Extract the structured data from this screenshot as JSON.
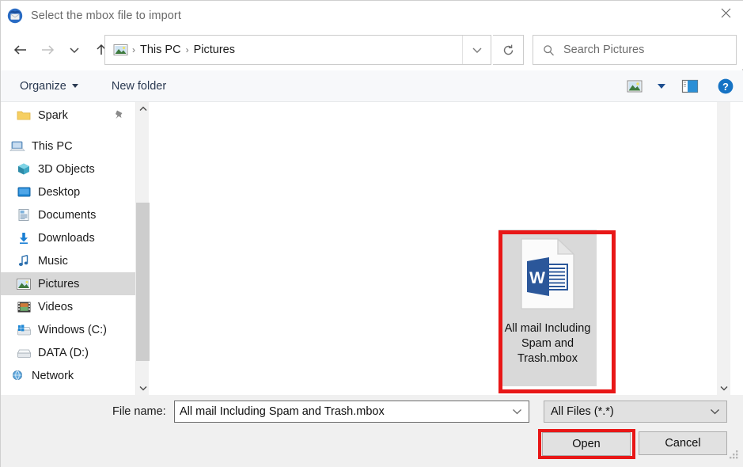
{
  "window": {
    "title": "Select the mbox file to import",
    "app_icon": "thunderbird-icon",
    "close_label": "✕"
  },
  "navigation": {
    "back_icon": "arrow-left-icon",
    "forward_icon": "arrow-right-icon",
    "recent_icon": "chevron-down-icon",
    "up_icon": "arrow-up-icon",
    "breadcrumb": {
      "location_icon": "pictures-folder-icon",
      "items": [
        "This PC",
        "Pictures"
      ],
      "separator": "›",
      "dropdown_icon": "chevron-down-icon"
    },
    "refresh_icon": "refresh-icon",
    "search": {
      "icon": "search-icon",
      "placeholder": "Search Pictures",
      "value": ""
    }
  },
  "toolbar": {
    "organize_label": "Organize",
    "new_folder_label": "New folder",
    "view_icon": "thumbnail-view-icon",
    "view_dropdown_icon": "chevron-down-icon",
    "preview_pane_icon": "preview-pane-icon",
    "help_icon": "help-icon",
    "help_label": "?"
  },
  "sidebar": {
    "items": [
      {
        "label": "Spark",
        "icon": "folder-icon",
        "selected": false,
        "pinned": true,
        "indent": 18
      },
      {
        "label": "This PC",
        "icon": "computer-icon",
        "selected": false,
        "pinned": false,
        "indent": 10
      },
      {
        "label": "3D Objects",
        "icon": "cube-icon",
        "selected": false,
        "pinned": false,
        "indent": 18
      },
      {
        "label": "Desktop",
        "icon": "desktop-icon",
        "selected": false,
        "pinned": false,
        "indent": 18
      },
      {
        "label": "Documents",
        "icon": "documents-icon",
        "selected": false,
        "pinned": false,
        "indent": 18
      },
      {
        "label": "Downloads",
        "icon": "downloads-icon",
        "selected": false,
        "pinned": false,
        "indent": 18
      },
      {
        "label": "Music",
        "icon": "music-icon",
        "selected": false,
        "pinned": false,
        "indent": 18
      },
      {
        "label": "Pictures",
        "icon": "pictures-icon",
        "selected": true,
        "pinned": false,
        "indent": 18
      },
      {
        "label": "Videos",
        "icon": "videos-icon",
        "selected": false,
        "pinned": false,
        "indent": 18
      },
      {
        "label": "Windows (C:)",
        "icon": "windows-drive-icon",
        "selected": false,
        "pinned": false,
        "indent": 18
      },
      {
        "label": "DATA (D:)",
        "icon": "drive-icon",
        "selected": false,
        "pinned": false,
        "indent": 18
      },
      {
        "label": "Network",
        "icon": "network-icon",
        "selected": false,
        "pinned": false,
        "indent": 10
      }
    ],
    "scroll_up_icon": "chevron-up-icon",
    "scroll_down_icon": "chevron-down-icon"
  },
  "file_list": {
    "scroll_down_icon": "chevron-down-icon",
    "files": [
      {
        "name": "All mail Including Spam and Trash.mbox",
        "name_lines": [
          "All mail Including",
          "Spam and",
          "Trash.mbox"
        ],
        "icon": "word-document-icon",
        "selected": true
      }
    ]
  },
  "footer": {
    "file_name_label": "File name:",
    "file_name_value": "All mail Including Spam and Trash.mbox",
    "file_name_caret_icon": "chevron-down-icon",
    "filter_value": "All Files (*.*)",
    "filter_caret_icon": "chevron-down-icon",
    "open_label": "Open",
    "cancel_label": "Cancel",
    "resize_grip_icon": "resize-grip-icon"
  },
  "annotations": {
    "highlight_color": "#e81717",
    "highlighted": [
      "file-tile-all-mail",
      "open-button"
    ]
  }
}
